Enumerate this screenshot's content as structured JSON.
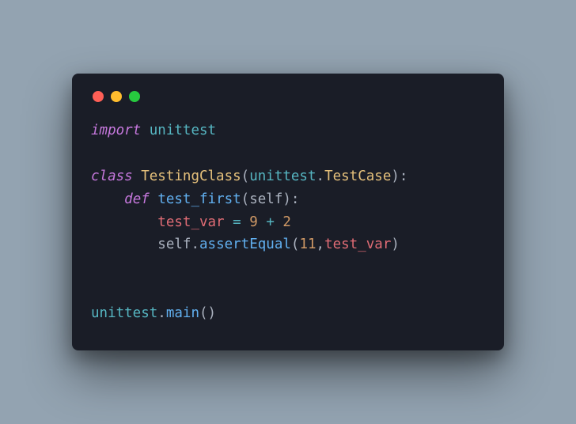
{
  "window": {
    "traffic_lights": [
      "close",
      "minimize",
      "zoom"
    ]
  },
  "code": {
    "l1": {
      "kw_import": "import",
      "module": "unittest"
    },
    "l3": {
      "kw_class": "class",
      "class_name": "TestingClass",
      "base_mod": "unittest",
      "base_cls": "TestCase"
    },
    "l4": {
      "kw_def": "def",
      "fn_name": "test_first",
      "param": "self"
    },
    "l5": {
      "var": "test_var",
      "eq": "=",
      "n1": "9",
      "plus": "+",
      "n2": "2"
    },
    "l6": {
      "self": "self",
      "method": "assertEqual",
      "arg_num": "11",
      "arg_var": "test_var"
    },
    "l9": {
      "mod": "unittest",
      "fn": "main"
    },
    "punct": {
      "lparen": "(",
      "rparen": ")",
      "colon": ":",
      "comma": ",",
      "dot": "."
    }
  }
}
